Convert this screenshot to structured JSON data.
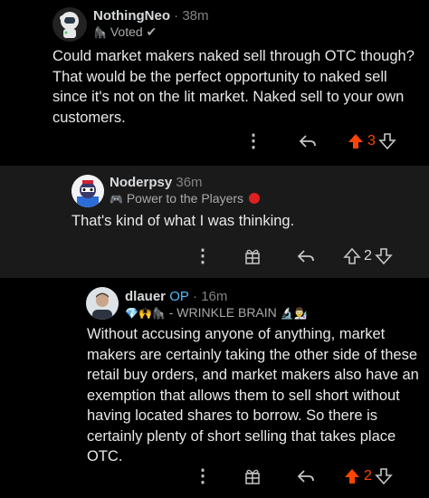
{
  "comments": [
    {
      "username": "NothingNeo",
      "time": "· 38m",
      "flair": "Voted ✔",
      "body": "Could market makers naked sell through OTC though? That would be the perfect opportunity to naked sell since it's not on the lit market. Naked sell to your own customers.",
      "score": "3",
      "upvoted": true
    },
    {
      "username": "Noderpsy",
      "time": "36m",
      "flair": "Power to the Players",
      "body": "That's kind of what I was thinking.",
      "score": "2",
      "upvoted": false
    },
    {
      "username": "dlauer",
      "op": "OP",
      "time": "· 16m",
      "flair": "- WRINKLE BRAIN",
      "body": "Without accusing anyone of anything, market makers are certainly taking the other side of these retail buy orders, and market makers also have an exemption that allows them to sell short without having located shares to borrow. So there is certainly plenty of short selling that takes place OTC.",
      "score": "2",
      "upvoted": true
    }
  ],
  "colors": {
    "upvote": "#ff4500",
    "background": "#000000",
    "nested_bg": "#1a1a1b",
    "op": "#4fbcff"
  }
}
